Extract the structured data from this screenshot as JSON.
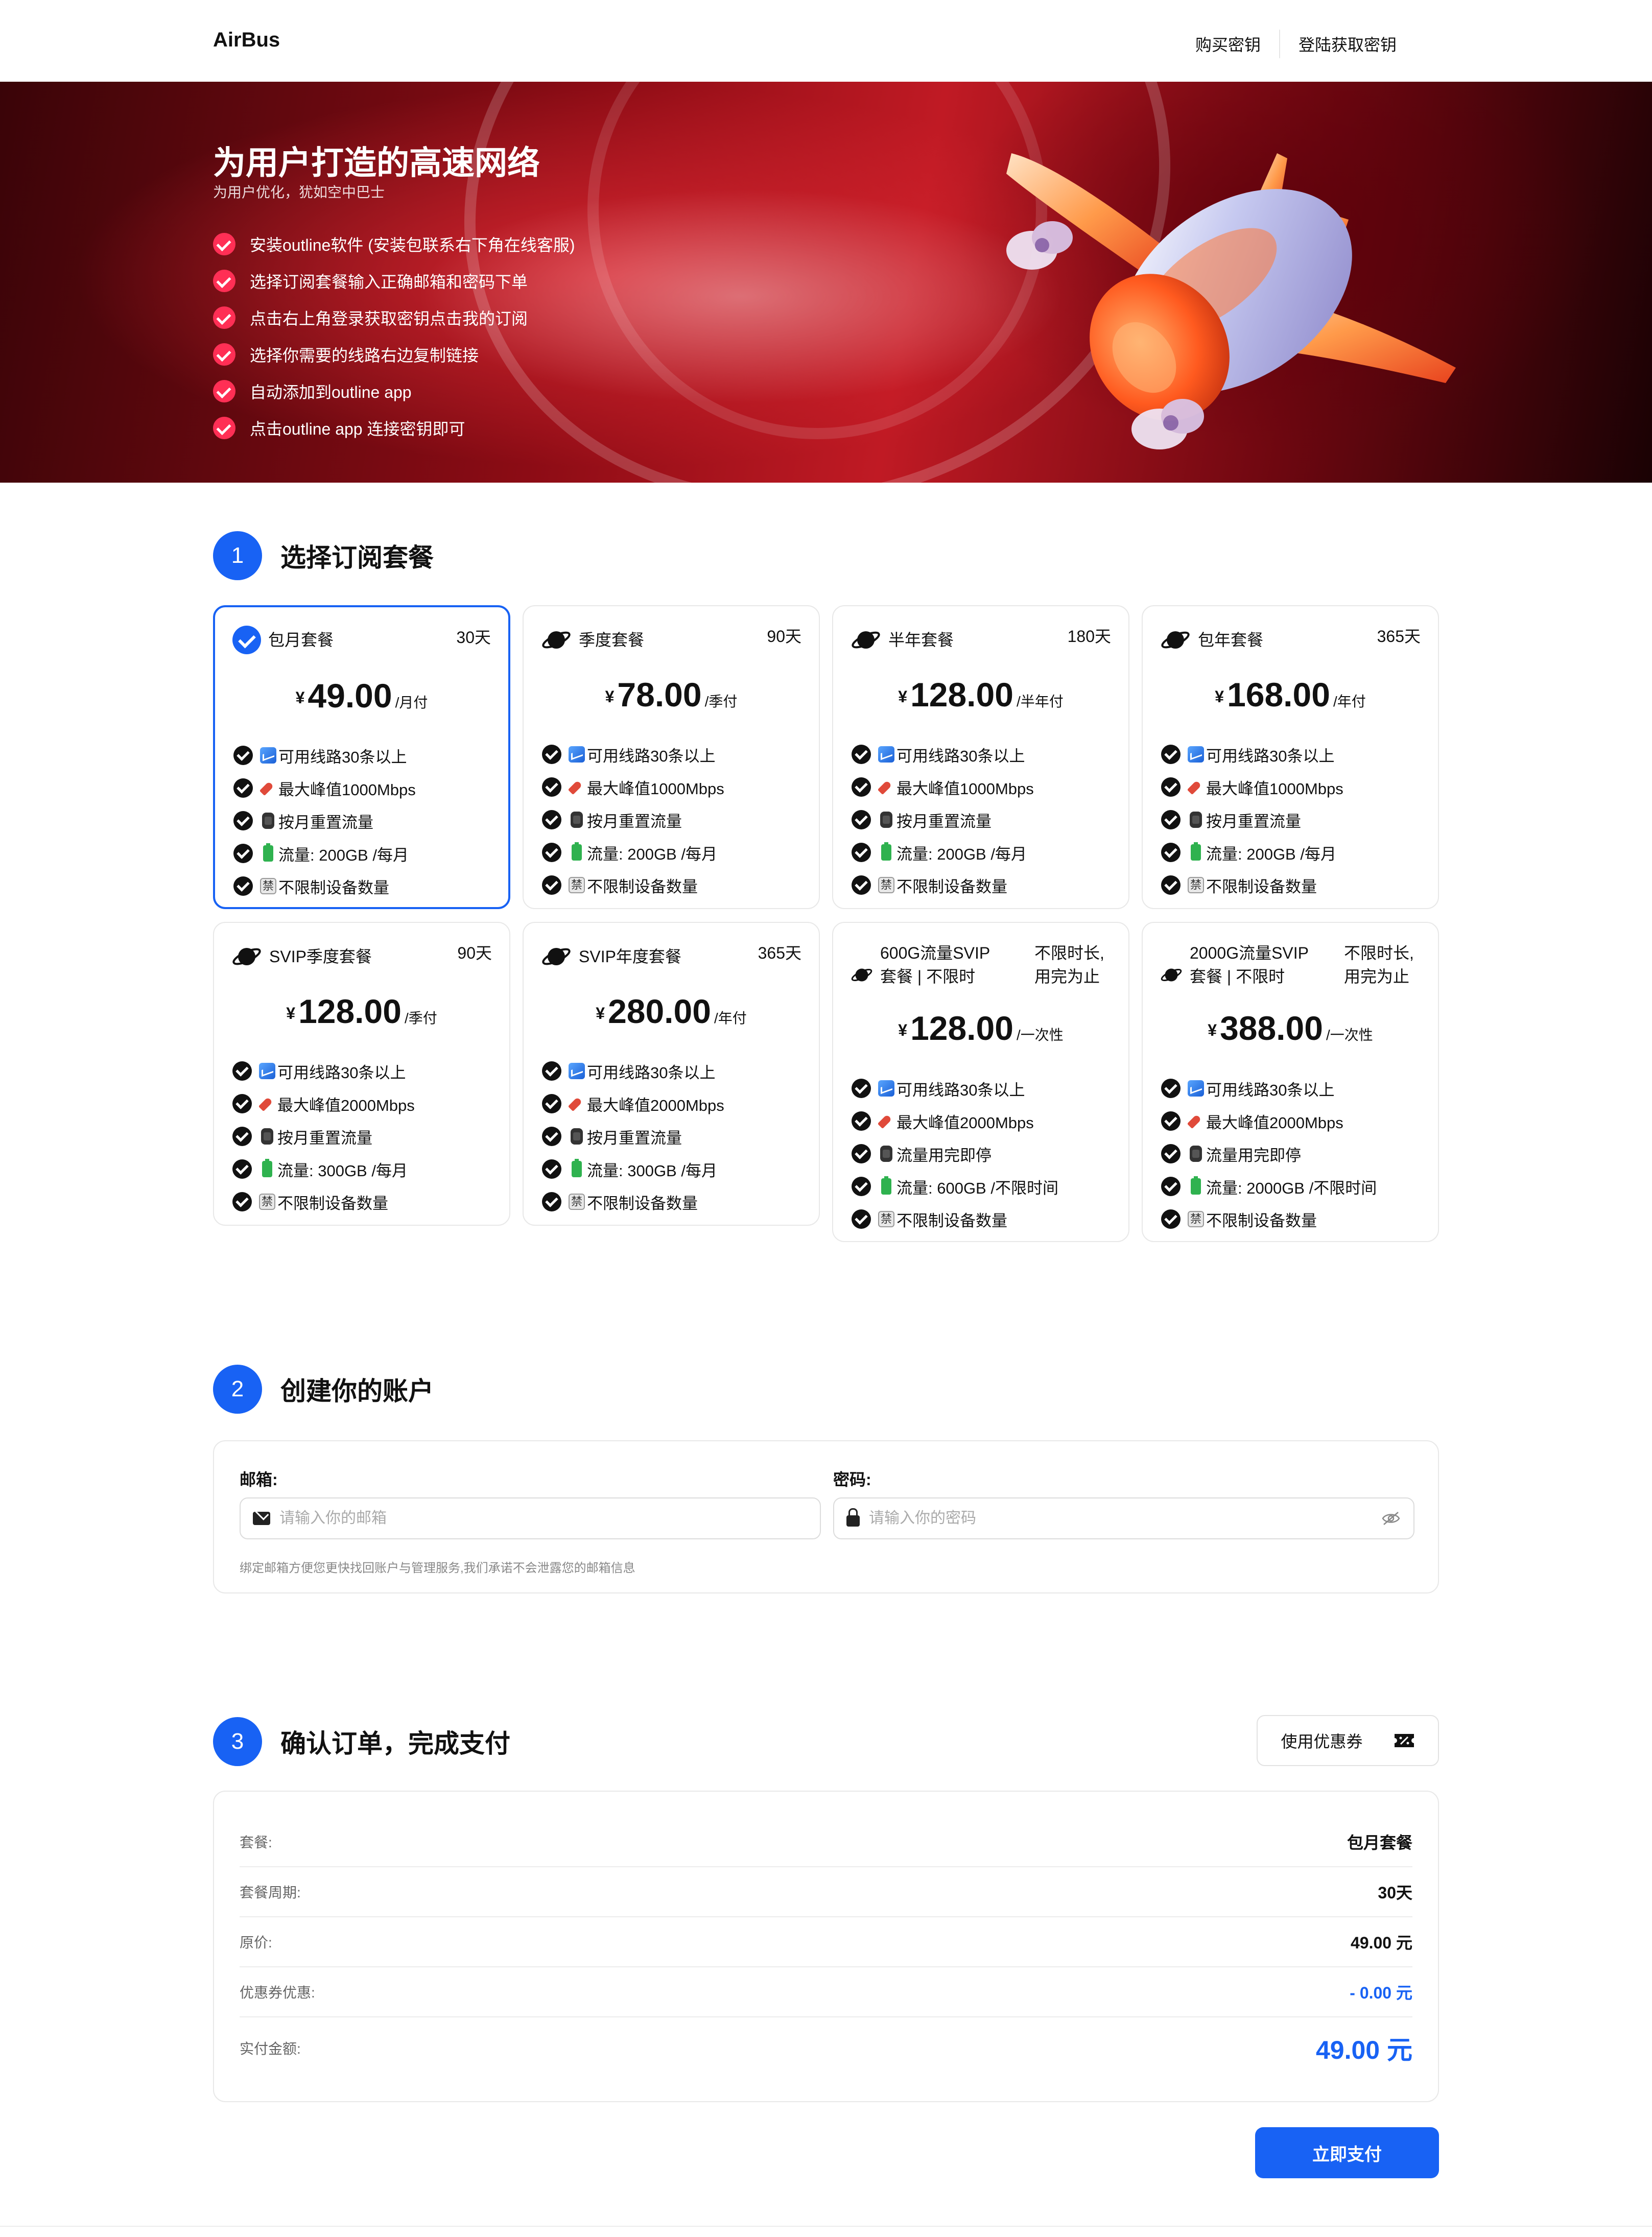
{
  "header": {
    "brand": "AirBus",
    "nav": [
      "购买密钥",
      "登陆获取密钥"
    ]
  },
  "hero": {
    "title": "为用户打造的高速网络",
    "subtitle": "为用户优化，犹如空中巴士",
    "steps": [
      "安装outline软件 (安装包联系右下角在线客服)",
      "选择订阅套餐输入正确邮箱和密码下单",
      "点击右上角登录获取密钥点击我的订阅",
      "选择你需要的线路右边复制链接",
      "自动添加到outline app",
      "点击outline app 连接密钥即可"
    ]
  },
  "section1": {
    "num": "1",
    "title": "选择订阅套餐"
  },
  "plans": [
    {
      "name": "包月套餐",
      "days": "30天",
      "currency": "¥",
      "price": "49.00",
      "per": "/月付",
      "selected": true,
      "features": [
        "可用线路30条以上",
        "最大峰值1000Mbps",
        "按月重置流量",
        "流量: 200GB /每月",
        "不限制设备数量"
      ]
    },
    {
      "name": "季度套餐",
      "days": "90天",
      "currency": "¥",
      "price": "78.00",
      "per": "/季付",
      "selected": false,
      "features": [
        "可用线路30条以上",
        "最大峰值1000Mbps",
        "按月重置流量",
        "流量: 200GB /每月",
        "不限制设备数量"
      ]
    },
    {
      "name": "半年套餐",
      "days": "180天",
      "currency": "¥",
      "price": "128.00",
      "per": "/半年付",
      "selected": false,
      "features": [
        "可用线路30条以上",
        "最大峰值1000Mbps",
        "按月重置流量",
        "流量: 200GB /每月",
        "不限制设备数量"
      ]
    },
    {
      "name": "包年套餐",
      "days": "365天",
      "currency": "¥",
      "price": "168.00",
      "per": "/年付",
      "selected": false,
      "features": [
        "可用线路30条以上",
        "最大峰值1000Mbps",
        "按月重置流量",
        "流量: 200GB /每月",
        "不限制设备数量"
      ]
    },
    {
      "name": "SVIP季度套餐",
      "days": "90天",
      "currency": "¥",
      "price": "128.00",
      "per": "/季付",
      "selected": false,
      "features": [
        "可用线路30条以上",
        "最大峰值2000Mbps",
        "按月重置流量",
        "流量: 300GB /每月",
        "不限制设备数量"
      ]
    },
    {
      "name": "SVIP年度套餐",
      "days": "365天",
      "currency": "¥",
      "price": "280.00",
      "per": "/年付",
      "selected": false,
      "features": [
        "可用线路30条以上",
        "最大峰值2000Mbps",
        "按月重置流量",
        "流量: 300GB /每月",
        "不限制设备数量"
      ]
    },
    {
      "name": "600G流量SVIP套餐 | 不限时",
      "days": "不限时长,用完为止",
      "currency": "¥",
      "price": "128.00",
      "per": "/一次性",
      "selected": false,
      "features": [
        "可用线路30条以上",
        "最大峰值2000Mbps",
        "流量用完即停",
        "流量: 600GB /不限时间",
        "不限制设备数量"
      ]
    },
    {
      "name": "2000G流量SVIP套餐 | 不限时",
      "days": "不限时长,用完为止",
      "currency": "¥",
      "price": "388.00",
      "per": "/一次性",
      "selected": false,
      "features": [
        "可用线路30条以上",
        "最大峰值2000Mbps",
        "流量用完即停",
        "流量: 2000GB /不限时间",
        "不限制设备数量"
      ]
    }
  ],
  "section2": {
    "num": "2",
    "title": "创建你的账户"
  },
  "account": {
    "email_label": "邮箱:",
    "email_placeholder": "请输入你的邮箱",
    "password_label": "密码:",
    "password_placeholder": "请输入你的密码",
    "hint": "绑定邮箱方便您更快找回账户与管理服务,我们承诺不会泄露您的邮箱信息"
  },
  "section3": {
    "num": "3",
    "title": "确认订单，完成支付"
  },
  "coupon_label": "使用优惠券",
  "order": [
    {
      "key": "套餐:",
      "value": "包月套餐"
    },
    {
      "key": "套餐周期:",
      "value": "30天"
    },
    {
      "key": "原价:",
      "value": "49.00 元"
    },
    {
      "key": "优惠券优惠:",
      "value": "- 0.00 元"
    },
    {
      "key": "实付金额:",
      "value": "49.00 元"
    }
  ],
  "pay_label": "立即支付",
  "colors": {
    "accent": "#1862f4",
    "hero_check": "#ff2f55",
    "hero_bg": "#8d0c15"
  },
  "icons": {
    "plan": "planet-icon",
    "selected": "check-circle-icon",
    "feature": "check-circle-icon",
    "email": "mail-icon",
    "password": "lock-icon",
    "toggle": "eye-off-icon",
    "coupon": "ticket-icon"
  }
}
